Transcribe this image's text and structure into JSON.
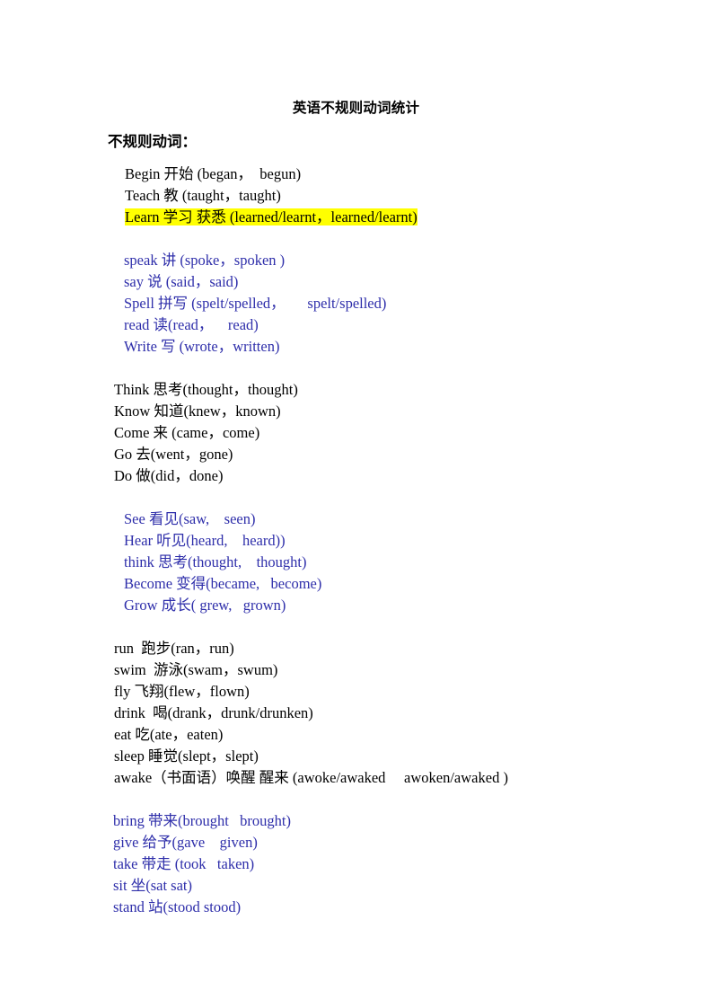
{
  "document": {
    "title": "英语不规则动词统计",
    "heading": "不规则动词：",
    "colors": {
      "text_black": "#000000",
      "text_blue": "#2e2eaa",
      "highlight_yellow": "#ffff00",
      "page_background": "#ffffff"
    }
  },
  "groups": [
    {
      "id": "group-1",
      "color": "black",
      "indent": "a",
      "lines": [
        {
          "text": "Begin 开始 (began，  begun)",
          "highlight": false
        },
        {
          "text": "Teach 教 (taught，taught)",
          "highlight": false
        },
        {
          "text": "Learn 学习 获悉 (learned/learnt，learned/learnt)",
          "highlight": true
        }
      ]
    },
    {
      "id": "group-2",
      "color": "blue",
      "indent": "b",
      "lines": [
        {
          "text": "speak 讲 (spoke，spoken )",
          "highlight": false
        },
        {
          "text": "say 说 (said，said)",
          "highlight": false
        },
        {
          "text": "Spell 拼写 (spelt/spelled，      spelt/spelled)",
          "highlight": false
        },
        {
          "text": "read 读(read，    read)",
          "highlight": false
        },
        {
          "text": "Write 写 (wrote，written)",
          "highlight": false
        }
      ]
    },
    {
      "id": "group-3",
      "color": "black",
      "indent": "c",
      "lines": [
        {
          "text": "Think 思考(thought，thought)",
          "highlight": false
        },
        {
          "text": "Know 知道(knew，known)",
          "highlight": false
        },
        {
          "text": "Come 来 (came，come)",
          "highlight": false
        },
        {
          "text": "Go 去(went，gone)",
          "highlight": false
        },
        {
          "text": "Do 做(did，done)",
          "highlight": false
        }
      ]
    },
    {
      "id": "group-4",
      "color": "blue",
      "indent": "b",
      "lines": [
        {
          "text": "See 看见(saw,    seen)",
          "highlight": false
        },
        {
          "text": "Hear 听见(heard,    heard))",
          "highlight": false
        },
        {
          "text": "think 思考(thought,    thought)",
          "highlight": false
        },
        {
          "text": "Become 变得(became,   become)",
          "highlight": false
        },
        {
          "text": "Grow 成长( grew,   grown)",
          "highlight": false
        }
      ]
    },
    {
      "id": "group-5",
      "color": "black",
      "indent": "c",
      "lines": [
        {
          "text": "run  跑步(ran，run)",
          "highlight": false
        },
        {
          "text": "swim  游泳(swam，swum)",
          "highlight": false
        },
        {
          "text": "fly 飞翔(flew，flown)",
          "highlight": false
        },
        {
          "text": "drink  喝(drank，drunk/drunken)",
          "highlight": false
        },
        {
          "text": "eat 吃(ate，eaten)",
          "highlight": false
        },
        {
          "text": "sleep 睡觉(slept，slept)",
          "highlight": false
        },
        {
          "text": "awake（书面语）唤醒 醒来 (awoke/awaked     awoken/awaked )",
          "highlight": false
        }
      ]
    },
    {
      "id": "group-6",
      "color": "blue",
      "indent": "d",
      "lines": [
        {
          "text": "bring 带来(brought   brought)",
          "highlight": false
        },
        {
          "text": "give 给予(gave    given)",
          "highlight": false
        },
        {
          "text": "take 带走 (took   taken)",
          "highlight": false
        },
        {
          "text": "sit 坐(sat sat)",
          "highlight": false
        },
        {
          "text": "stand 站(stood stood)",
          "highlight": false
        }
      ]
    }
  ]
}
